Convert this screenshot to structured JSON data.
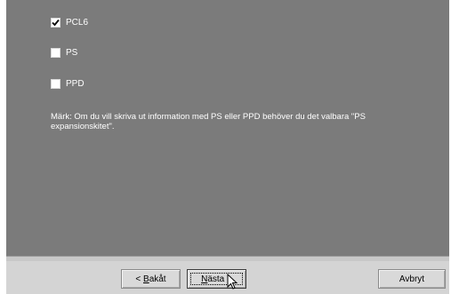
{
  "options": [
    {
      "label": "PCL6",
      "checked": true
    },
    {
      "label": "PS",
      "checked": false
    },
    {
      "label": "PPD",
      "checked": false
    }
  ],
  "note": "Märk: Om du vill skriva ut information med PS eller PPD behöver du det valbara \"PS expansionskitet\".",
  "buttons": {
    "back_prefix": "< ",
    "back_mnemonic": "B",
    "back_rest": "akåt",
    "next_mnemonic": "N",
    "next_rest": "ästa >",
    "cancel": "Avbryt"
  },
  "icons": {
    "checkmark": "check-icon",
    "cursor": "arrow-pointer-icon"
  },
  "colors": {
    "panel": "#7b7b7b",
    "footer": "#d4d4d4"
  }
}
